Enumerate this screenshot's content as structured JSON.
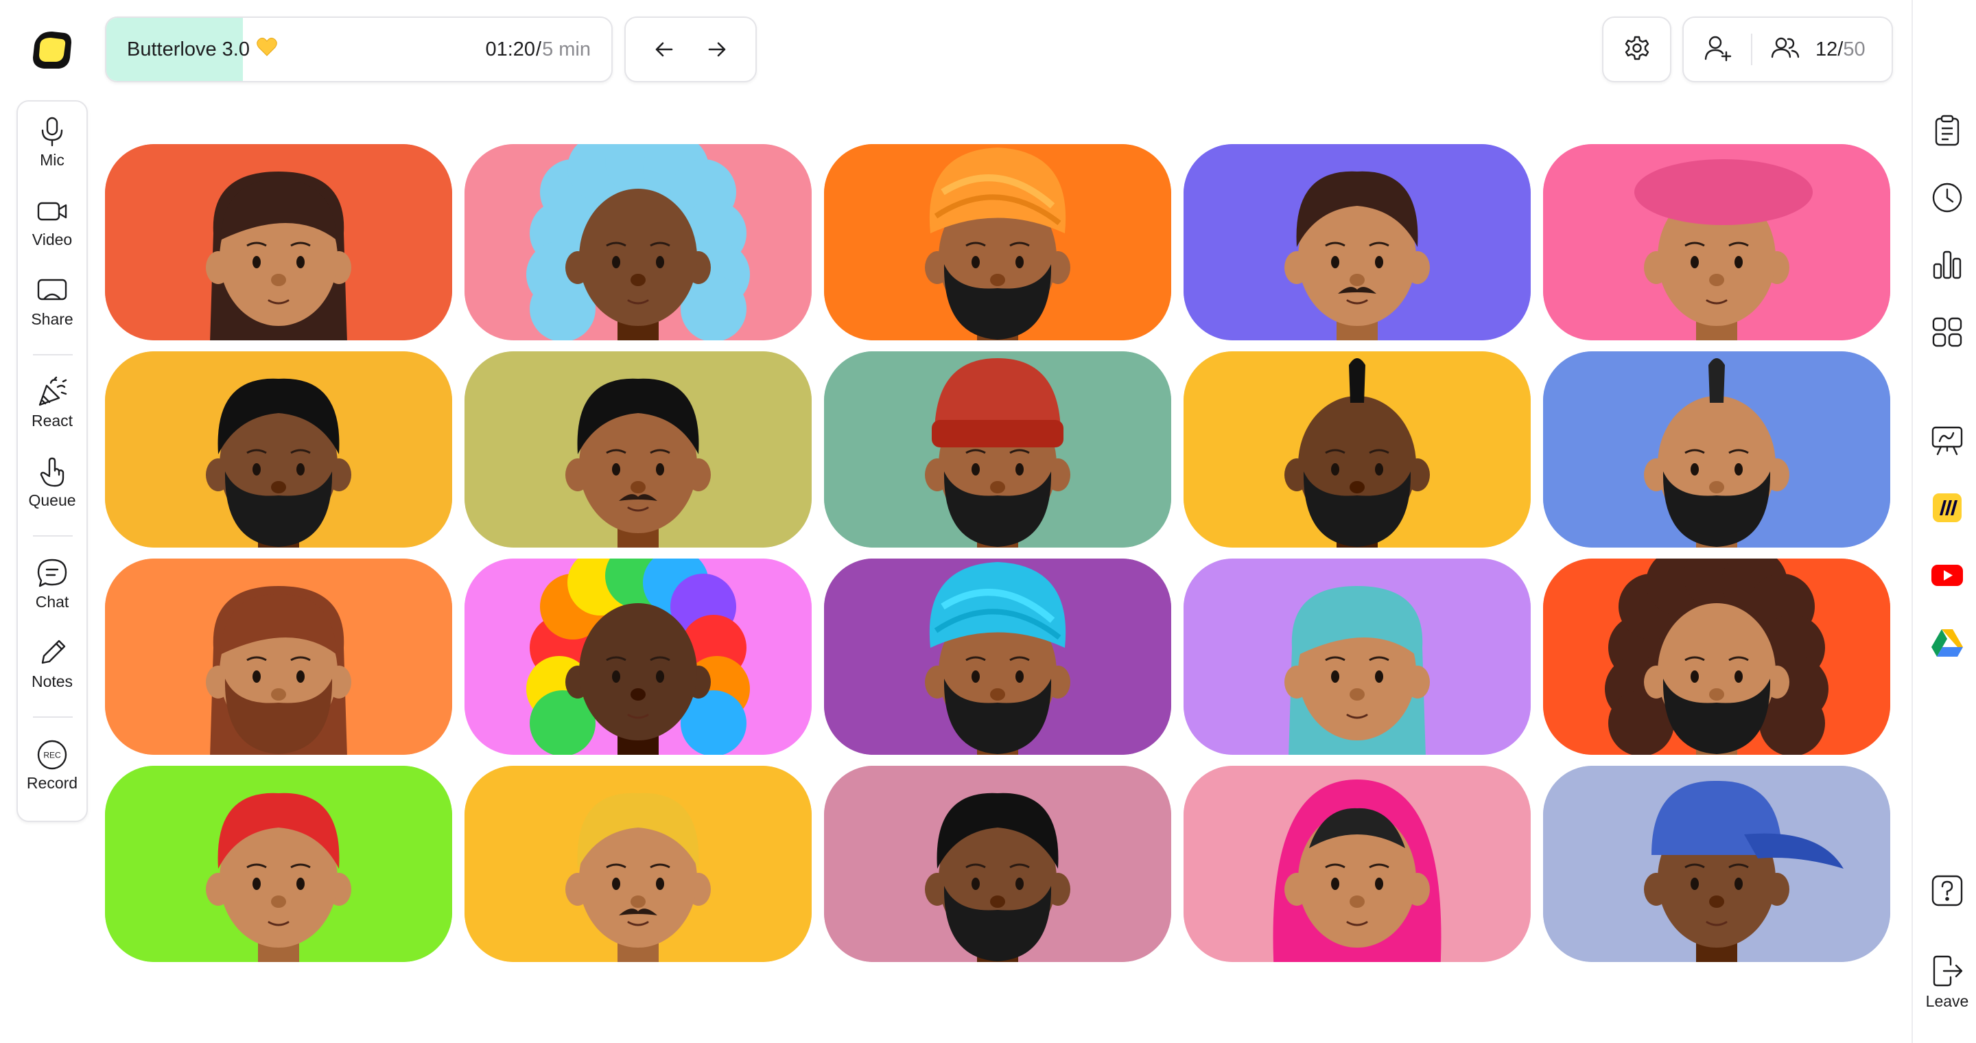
{
  "app": {
    "logo_icon": "app-logo",
    "accent": "#ffe94a"
  },
  "timer": {
    "title": "Butterlove 3.0",
    "title_emoji_icon": "yellow-heart-icon",
    "elapsed": "01:20",
    "separator": "/",
    "total": "5 min",
    "progress": 0.27,
    "progress_color": "#c9f5e6"
  },
  "nav": {
    "prev_icon": "arrow-left-icon",
    "next_icon": "arrow-right-icon"
  },
  "header": {
    "settings_icon": "gear-icon",
    "invite_icon": "add-user-icon",
    "people_icon": "people-icon",
    "participants_current": "12",
    "participants_separator": "/",
    "participants_max": "50"
  },
  "left_sidebar": {
    "items": [
      {
        "label": "Mic",
        "icon": "mic-icon"
      },
      {
        "label": "Video",
        "icon": "video-icon"
      },
      {
        "label": "Share",
        "icon": "screen-share-icon"
      },
      {
        "label": "React",
        "icon": "confetti-icon"
      },
      {
        "label": "Queue",
        "icon": "raise-hand-icon"
      },
      {
        "label": "Chat",
        "icon": "chat-icon"
      },
      {
        "label": "Notes",
        "icon": "pencil-icon"
      },
      {
        "label": "Record",
        "icon": "rec-icon"
      }
    ]
  },
  "right_rail": {
    "items": [
      {
        "icon": "clipboard-icon"
      },
      {
        "icon": "clock-icon"
      },
      {
        "icon": "bar-chart-icon"
      },
      {
        "icon": "apps-grid-icon"
      },
      {
        "icon": "whiteboard-icon"
      },
      {
        "icon": "miro-icon"
      },
      {
        "icon": "youtube-icon"
      },
      {
        "icon": "google-drive-icon"
      },
      {
        "icon": "help-icon"
      }
    ],
    "leave_label": "Leave",
    "leave_icon": "leave-icon"
  },
  "participants": [
    {
      "bg": "#f0603a",
      "skin": "#c98a5c",
      "hair": "#3b2018",
      "style": "long",
      "beard": "none"
    },
    {
      "bg": "#f78a9b",
      "skin": "#7a4a2c",
      "hair": "#7fd0f0",
      "style": "curly",
      "beard": "none"
    },
    {
      "bg": "#ff7a1a",
      "skin": "#a2643c",
      "hair": "#ff9a2e",
      "style": "turban",
      "beard": "black"
    },
    {
      "bg": "#7768f0",
      "skin": "#c98a5c",
      "hair": "#3b2018",
      "style": "short",
      "beard": "mustache"
    },
    {
      "bg": "#fb6aa0",
      "skin": "#c98a5c",
      "hair": "#e8508a",
      "style": "beret",
      "beard": "none"
    },
    {
      "bg": "#f8b62e",
      "skin": "#7a4a2c",
      "hair": "#111111",
      "style": "short",
      "beard": "black"
    },
    {
      "bg": "#c5c064",
      "skin": "#a2643c",
      "hair": "#111111",
      "style": "short",
      "beard": "mustache"
    },
    {
      "bg": "#79b69c",
      "skin": "#a2643c",
      "hair": "#c23a2a",
      "style": "beanie",
      "beard": "black"
    },
    {
      "bg": "#fbbd2b",
      "skin": "#6a3e22",
      "hair": "#111111",
      "style": "mohawk",
      "beard": "black"
    },
    {
      "bg": "#6b8fe6",
      "skin": "#c98a5c",
      "hair": "#222222",
      "style": "mohawk",
      "beard": "black"
    },
    {
      "bg": "#ff8a42",
      "skin": "#c98a5c",
      "hair": "#8a3f22",
      "style": "long",
      "beard": "brown"
    },
    {
      "bg": "#f982f5",
      "skin": "#5a3520",
      "hair": "#ff9a00",
      "style": "rainbow",
      "beard": "none"
    },
    {
      "bg": "#9a48b0",
      "skin": "#a2643c",
      "hair": "#28c0e8",
      "style": "turban",
      "beard": "black"
    },
    {
      "bg": "#c48af5",
      "skin": "#c98a5c",
      "hair": "#58c0c8",
      "style": "long",
      "beard": "none"
    },
    {
      "bg": "#ff5522",
      "skin": "#c98a5c",
      "hair": "#4a2418",
      "style": "curly",
      "beard": "black"
    },
    {
      "bg": "#82ec2a",
      "skin": "#c98a5c",
      "hair": "#e02a2a",
      "style": "short",
      "beard": "none"
    },
    {
      "bg": "#fbbd2b",
      "skin": "#c98a5c",
      "hair": "#f0c030",
      "style": "short",
      "beard": "mustache"
    },
    {
      "bg": "#d68aa5",
      "skin": "#7a4a2c",
      "hair": "#111111",
      "style": "short",
      "beard": "black"
    },
    {
      "bg": "#f29ab0",
      "skin": "#c98a5c",
      "hair": "#f0208a",
      "style": "hijab",
      "beard": "none"
    },
    {
      "bg": "#a8b4dc",
      "skin": "#7a4a2c",
      "hair": "#3f62c8",
      "style": "cap",
      "beard": "none"
    }
  ]
}
